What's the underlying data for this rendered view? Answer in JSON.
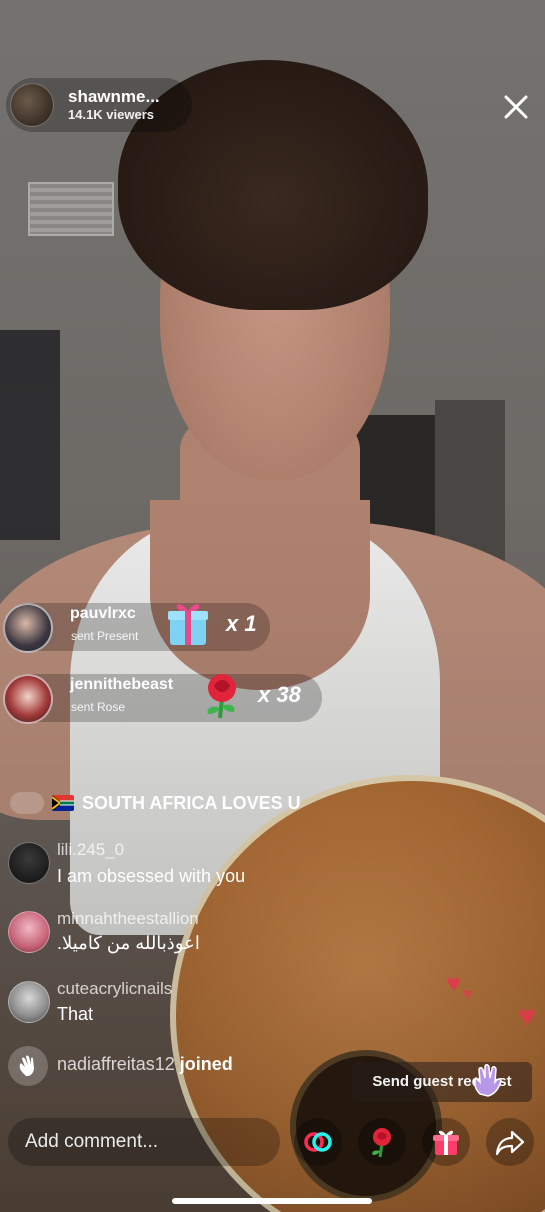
{
  "host": {
    "name": "shawnme...",
    "viewers": "14.1K viewers"
  },
  "gifts": [
    {
      "user": "pauvlrxc",
      "action": "sent Present",
      "gift_icon": "gift-box-icon",
      "count": "x 1"
    },
    {
      "user": "jennithebeast",
      "action": "sent Rose",
      "gift_icon": "rose-icon",
      "count": "x 38"
    }
  ],
  "banner": {
    "text": "SOUTH AFRICA LOVES U"
  },
  "comments": [
    {
      "user": "lili.245_0",
      "text": "I am obsessed with you"
    },
    {
      "user": "minnahtheestallion",
      "text": "اعوذبالله من كاميلا."
    },
    {
      "user": "cuteacrylicnails",
      "text": "That"
    }
  ],
  "joined": {
    "user": "nadiaffreitas12",
    "action": "joined"
  },
  "guest_request": {
    "label": "Send guest request"
  },
  "bottom_bar": {
    "comment_placeholder": "Add comment..."
  },
  "colors": {
    "accent_pink": "#fe2c55",
    "accent_cyan": "#25f4ee"
  }
}
